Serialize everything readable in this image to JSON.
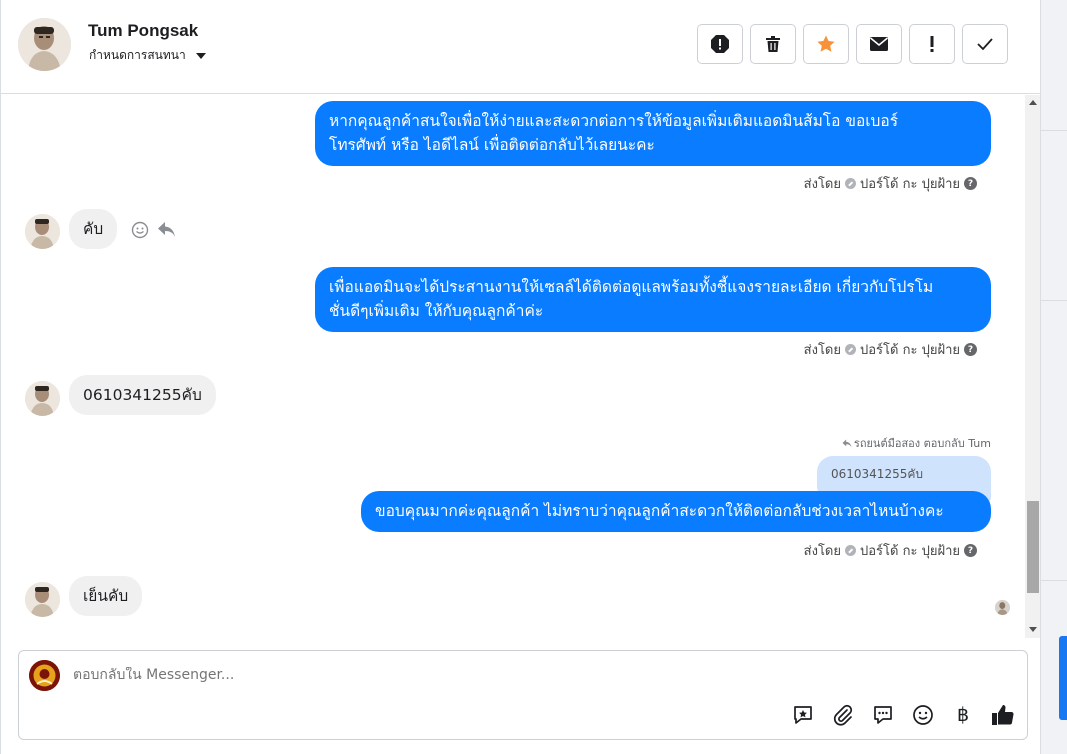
{
  "header": {
    "name": "Tum Pongsak",
    "assign_label": "กำหนดการสนทนา"
  },
  "header_actions": [
    {
      "icon": "alert-circle-icon"
    },
    {
      "icon": "trash-icon"
    },
    {
      "icon": "star-icon",
      "color": "#f7923b"
    },
    {
      "icon": "envelope-icon"
    },
    {
      "icon": "exclamation-icon"
    },
    {
      "icon": "check-icon"
    }
  ],
  "messages": [
    {
      "direction": "out",
      "text_line1": "หากคุณลูกค้าสนใจเพื่อให้ง่ายและสะดวกต่อการให้ข้อมูลเพิ่มเติมแอดมินส้มโอ ขอเบอร์",
      "text_line2": "โทรศัพท์ หรือ ไอดีไลน์ เพื่อติดต่อกลับไว้เลยนะคะ",
      "sent_by_prefix": "ส่งโดย",
      "sent_by": "ปอร์โด้ กะ ปุยฝ้าย"
    },
    {
      "direction": "in",
      "text": "คับ"
    },
    {
      "direction": "out",
      "text_line1": "เพื่อแอดมินจะได้ประสานงานให้เซลล์ได้ติดต่อดูแลพร้อมทั้งชี้แจงรายละเอียด เกี่ยวกับโปรโม",
      "text_line2": "ชั่นดีๆเพิ่มเติม ให้กับคุณลูกค้าค่ะ",
      "sent_by_prefix": "ส่งโดย",
      "sent_by": "ปอร์โด้ กะ ปุยฝ้าย"
    },
    {
      "direction": "in",
      "text": "0610341255คับ"
    },
    {
      "direction": "out",
      "reply_note": "รถยนต์มือสอง ตอบกลับ Tum",
      "quoted": "0610341255คับ",
      "text": "ขอบคุณมากค่ะคุณลูกค้า ไม่ทราบว่าคุณลูกค้าสะดวกให้ติดต่อกลับช่วงเวลาไหนบ้างคะ",
      "sent_by_prefix": "ส่งโดย",
      "sent_by": "ปอร์โด้ กะ ปุยฝ้าย"
    },
    {
      "direction": "in",
      "text": "เย็นคับ"
    }
  ],
  "composer": {
    "placeholder": "ตอบกลับใน Messenger...",
    "tools": [
      "saved-reply-icon",
      "attachment-icon",
      "chat-bubbles-icon",
      "emoji-icon",
      "baht-icon",
      "thumbs-up-icon"
    ]
  },
  "accent": "#0a7cff"
}
